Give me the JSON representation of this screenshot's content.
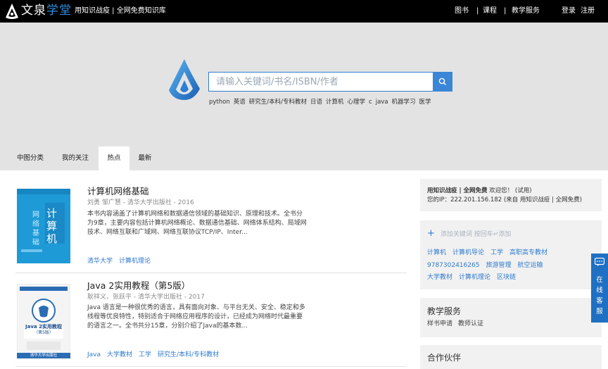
{
  "topbar": {
    "logo_text_1": "文泉",
    "logo_text_2": "学堂",
    "tagline": "用知识战疫 | 全网免费知识库",
    "nav": [
      "图书",
      "课程",
      "教学服务"
    ],
    "nav_sep": "|",
    "login": "登录",
    "register": "注册"
  },
  "search": {
    "placeholder": "请输入关键词/书名/ISBN/作者",
    "hot_tags": [
      "python",
      "英语",
      "研究生/本科/专科教材",
      "日语",
      "计算机",
      "心理学",
      "c",
      "java",
      "机器学习",
      "医学"
    ]
  },
  "tabs": [
    "中图分类",
    "我的关注",
    "热点",
    "最新"
  ],
  "active_tab": "热点",
  "books": [
    {
      "title": "计算机网络基础",
      "meta": "刘勇 邹广慧 - 清华大学出版社 - 2016",
      "desc": "本书内容涵盖了计算机网络和数据通信领域的基础知识、原理和技术。全书分为9章，主要内容包括计算机网络概论、数据通信基础、网络体系结构、局域网技术、网络互联和广域网、网络互联协议TCP/IP、Inter...",
      "tags": [
        "清华大学",
        "计算机理论"
      ],
      "cover_title": "计算机网络基础"
    },
    {
      "title": "Java 2实用教程（第5版）",
      "meta": "耿祥义、张跃平 - 清华大学出版社 - 2017",
      "desc": "Java 语言是一种很优秀的语言，具有面向对象、与平台无关、安全、稳定和多线程等优良特性，特别适合于网络应用程序的设计，已经成为网络时代最重要的语言之一。全书共分15章，分别介绍了Java的基本数...",
      "tags": [
        "Java",
        "大学教材",
        "工学",
        "研究生/本科/专科教材"
      ],
      "cover_title": "Java 2实用教程",
      "cover_edition": "（第5版）",
      "cover_publisher": "清华大学出版社"
    }
  ],
  "sidebar": {
    "welcome_bold": "用知识战疫 | 全网免费",
    "welcome_rest": " 欢迎您！ (试用)",
    "ip_line": "您的IP：222.201.156.182 (来自 用知识战疫 | 全网免费)",
    "add_keyword": "添加关键词 按回车↵添加",
    "keyword_lines": [
      [
        "计算机",
        "计算机导论",
        "工学",
        "高职高专教材"
      ],
      [
        "9787302416265",
        "旅游管理",
        "航空运输"
      ],
      [
        "大学教材",
        "计算机理论",
        "区块链"
      ]
    ],
    "service_title": "教学服务",
    "service_links": [
      "样书申请",
      "教师认证"
    ],
    "partner_title": "合作伙伴"
  },
  "online_service": [
    "在",
    "线",
    "客",
    "服"
  ],
  "colors": {
    "accent": "#2f7bcf",
    "topbar_bg": "#000000",
    "hero_bg": "#e3e3e4",
    "online_bg": "#1f6fc2"
  }
}
